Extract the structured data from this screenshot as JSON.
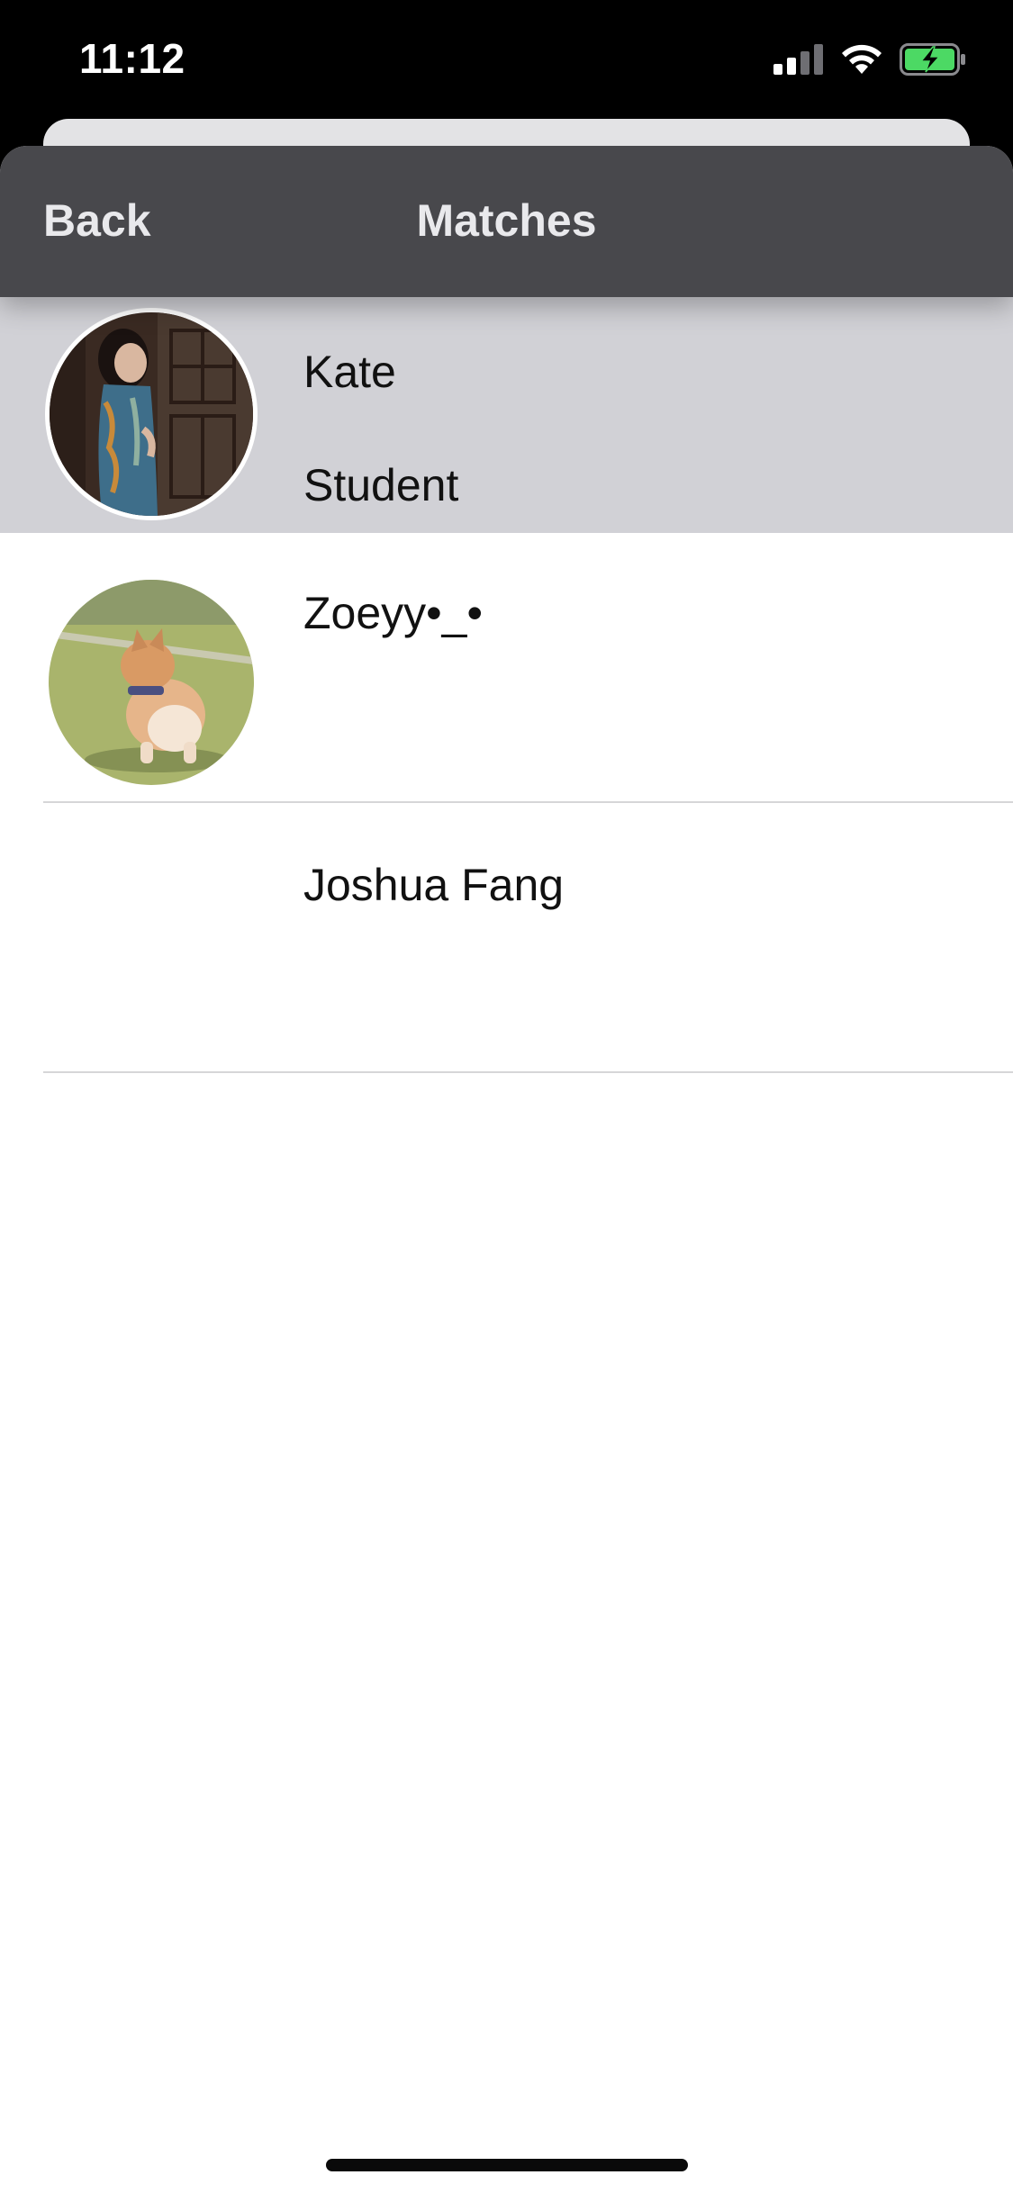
{
  "status_bar": {
    "time": "11:12",
    "icons": [
      "cellular-signal-icon",
      "wifi-icon",
      "battery-charging-icon"
    ],
    "battery_color": "#4cd964"
  },
  "nav": {
    "back_label": "Back",
    "title": "Matches",
    "background_color": "#48484c"
  },
  "matches": [
    {
      "name": "Kate",
      "subtitle": "Student",
      "selected": true,
      "avatar": "photo-woman-avatar"
    },
    {
      "name": "Zoeyy•_•",
      "subtitle": "",
      "selected": false,
      "avatar": "photo-corgi-avatar"
    },
    {
      "name": "Joshua Fang",
      "subtitle": "",
      "selected": false,
      "avatar": ""
    }
  ],
  "colors": {
    "selected_row": "#d1d1d6",
    "separator": "#d6d6d8"
  }
}
